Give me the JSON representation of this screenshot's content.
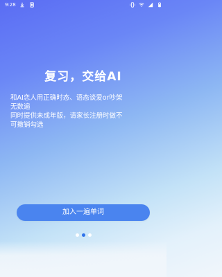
{
  "status_bar": {
    "time": "9:28",
    "icons": [
      "download-icon",
      "signal-icon",
      "vibrate-icon",
      "wifi-icon",
      "signal-strength-icon",
      "battery-icon"
    ]
  },
  "hero": {
    "title": "复习，交给AI",
    "description_lines": [
      "和AI恋人用正确时态、语态谈爱or吵架",
      "无数遍",
      "同时提供未成年版，请家长注册时做不",
      "可撤销勾选"
    ]
  },
  "actions": {
    "primary_label": "加入一遍单词"
  },
  "pagination": {
    "current": 2,
    "total": 3
  },
  "colors": {
    "button": "#4a84ef",
    "active_dot": "#2f72ea",
    "text": "#ffffff"
  }
}
